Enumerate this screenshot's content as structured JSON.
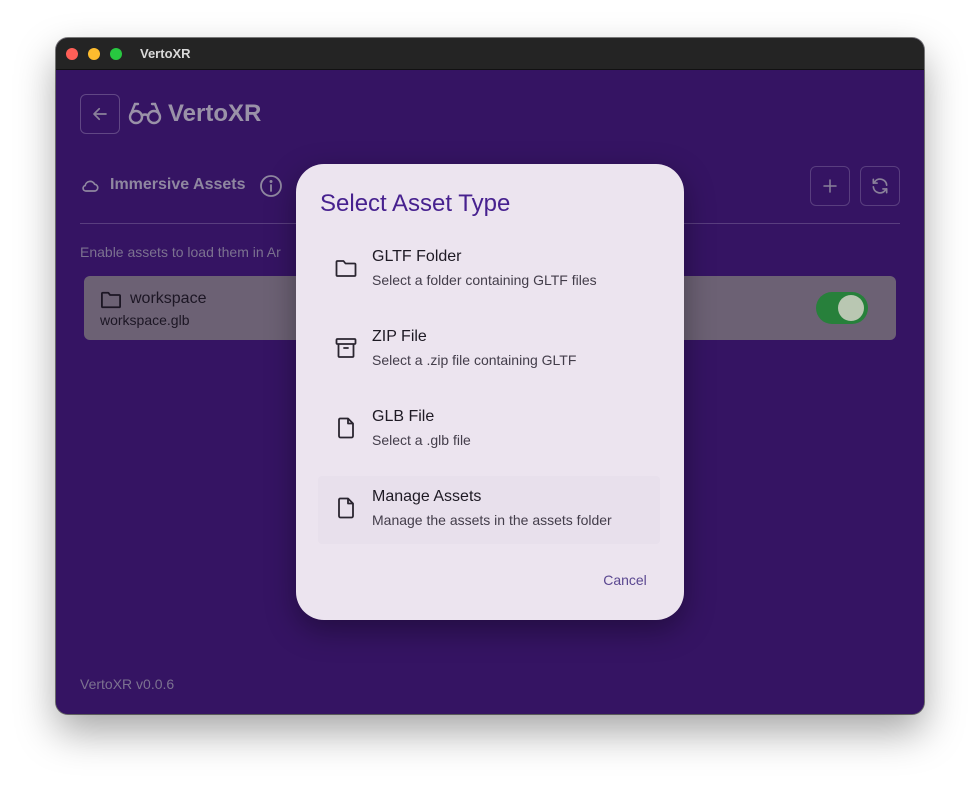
{
  "window": {
    "title": "VertoXR"
  },
  "header": {
    "brand": "VertoXR"
  },
  "section": {
    "title": "Immersive Assets",
    "hint": "Enable assets to load them in Ar"
  },
  "asset": {
    "name": "workspace",
    "file": "workspace.glb",
    "enabled": true
  },
  "footer": {
    "version": "VertoXR v0.0.6"
  },
  "dialog": {
    "title": "Select Asset Type",
    "options": [
      {
        "title": "GLTF Folder",
        "subtitle": "Select a folder containing GLTF files",
        "icon": "folder-icon"
      },
      {
        "title": "ZIP File",
        "subtitle": "Select a .zip file containing GLTF",
        "icon": "archive-icon"
      },
      {
        "title": "GLB File",
        "subtitle": "Select a .glb file",
        "icon": "file-icon"
      },
      {
        "title": "Manage Assets",
        "subtitle": "Manage the assets in the assets folder",
        "icon": "file-icon"
      }
    ],
    "cancel": "Cancel"
  },
  "colors": {
    "background": "#351463",
    "dialog": "#ece4ef",
    "accent": "#47218f",
    "toggle_on": "#27803b"
  }
}
